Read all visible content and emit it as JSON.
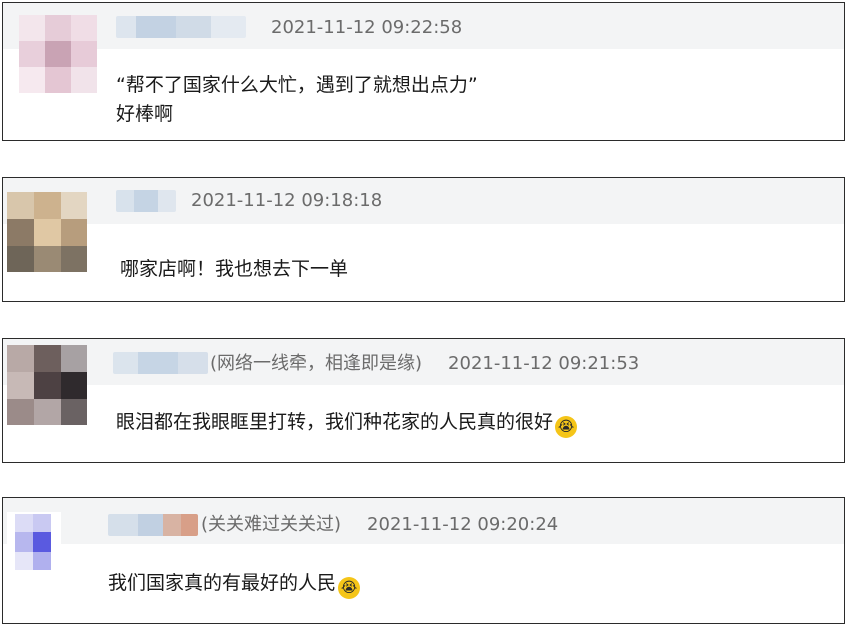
{
  "comments": [
    {
      "handle": "",
      "timestamp": "2021-11-12 09:22:58",
      "lines": [
        "“帮不了国家什么大忙，遇到了就想出点力”",
        "好棒啊"
      ],
      "emoji": ""
    },
    {
      "handle": "",
      "timestamp": "2021-11-12 09:18:18",
      "lines": [
        "哪家店啊！我也想去下一单"
      ],
      "emoji": ""
    },
    {
      "handle": "(网络一线牵，相逢即是缘)",
      "timestamp": "2021-11-12 09:21:53",
      "lines": [
        "眼泪都在我眼眶里打转，我们种花家的人民真的很好"
      ],
      "emoji": "😭"
    },
    {
      "handle": "(关关难过关关过)",
      "timestamp": "2021-11-12 09:20:24",
      "lines": [
        "我们国家真的有最好的人民"
      ],
      "emoji": "😭"
    }
  ],
  "emoji_icon": "loudly-crying-face-icon"
}
